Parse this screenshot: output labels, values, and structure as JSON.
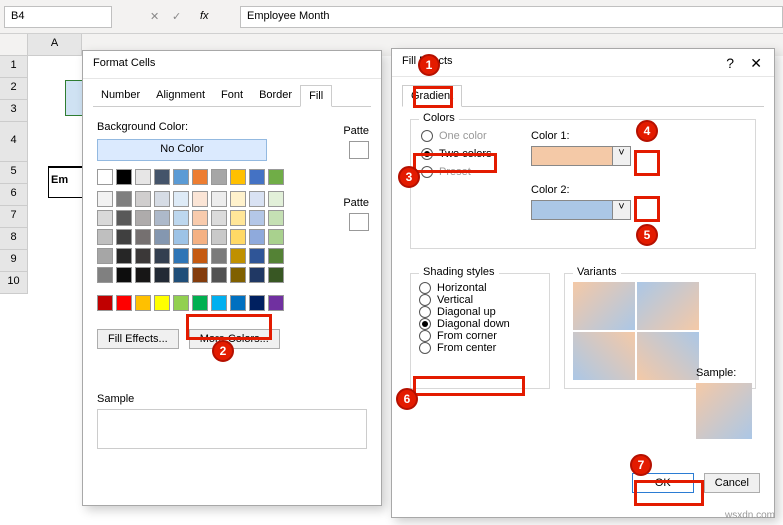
{
  "ribbon": {
    "name_box": "B4",
    "fx_label": "fx",
    "formula_text": "Employee Month"
  },
  "columns": [
    "A"
  ],
  "rows": [
    "1",
    "2",
    "3",
    "4",
    "5",
    "6",
    "7",
    "8",
    "9",
    "10"
  ],
  "sheet": {
    "em_cell": "Em"
  },
  "format_cells": {
    "title": "Format Cells",
    "tabs": [
      "Number",
      "Alignment",
      "Font",
      "Border",
      "Fill"
    ],
    "bg_label": "Background Color:",
    "no_color": "No Color",
    "fill_effects_btn": "Fill Effects...",
    "more_colors_btn": "More Colors...",
    "sample_label": "Sample",
    "pattern_lbl1": "Patte",
    "pattern_lbl2": "Patte",
    "theme_row1": [
      "#ffffff",
      "#000000",
      "#e7e6e6",
      "#44546a",
      "#5b9bd5",
      "#ed7d31",
      "#a6a6a6",
      "#ffc000",
      "#4472c4",
      "#70ad47"
    ],
    "theme_shades": [
      [
        "#f2f2f2",
        "#7f7f7f",
        "#d0cece",
        "#d6dce5",
        "#deebf7",
        "#fbe5d6",
        "#ededed",
        "#fff2cc",
        "#d9e2f3",
        "#e2f0d9"
      ],
      [
        "#d9d9d9",
        "#595959",
        "#aeabab",
        "#adb9ca",
        "#bdd7ee",
        "#f8cbad",
        "#dbdbdb",
        "#ffe699",
        "#b4c7e7",
        "#c5e0b4"
      ],
      [
        "#bfbfbf",
        "#404040",
        "#757070",
        "#8497b0",
        "#9dc3e6",
        "#f4b183",
        "#c9c9c9",
        "#ffd966",
        "#8faadc",
        "#a9d18e"
      ],
      [
        "#a6a6a6",
        "#262626",
        "#3b3838",
        "#333f50",
        "#2e75b6",
        "#c55a11",
        "#7b7b7b",
        "#bf9000",
        "#2f5597",
        "#548235"
      ],
      [
        "#808080",
        "#0d0d0d",
        "#171616",
        "#222a35",
        "#1f4e79",
        "#843c0c",
        "#525252",
        "#806000",
        "#203864",
        "#385723"
      ]
    ],
    "standard_colors": [
      "#c00000",
      "#ff0000",
      "#ffc000",
      "#ffff00",
      "#92d050",
      "#00b050",
      "#00b0f0",
      "#0070c0",
      "#002060",
      "#7030a0"
    ]
  },
  "fill_effects": {
    "title": "Fill Effects",
    "tab": "Gradient",
    "colors_group": "Colors",
    "one_color": "One color",
    "two_colors": "Two colors",
    "preset": "Preset",
    "color1_label": "Color 1:",
    "color2_label": "Color 2:",
    "shading_group": "Shading styles",
    "horizontal": "Horizontal",
    "vertical": "Vertical",
    "diag_up": "Diagonal up",
    "diag_down": "Diagonal down",
    "from_corner": "From corner",
    "from_center": "From center",
    "variants_group": "Variants",
    "sample_label": "Sample:",
    "ok": "OK",
    "cancel": "Cancel"
  },
  "callouts": {
    "c1": "1",
    "c2": "2",
    "c3": "3",
    "c4": "4",
    "c5": "5",
    "c6": "6",
    "c7": "7"
  },
  "watermark": "wsxdn.com"
}
